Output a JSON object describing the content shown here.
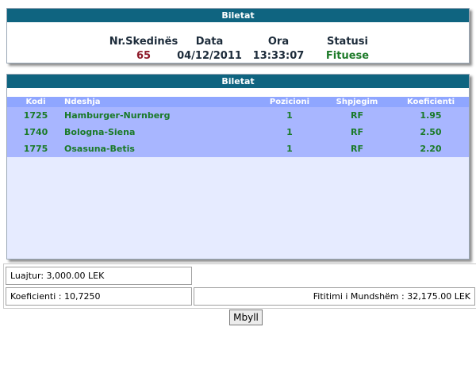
{
  "summary_panel": {
    "title": "Biletat",
    "headers": [
      "Nr.Skedinës",
      "Data",
      "Ora",
      "Statusi"
    ],
    "values": [
      "65",
      "04/12/2011",
      "13:33:07",
      "Fituese"
    ],
    "value_colors": [
      "#8e1a2a",
      "#1c2b3a",
      "#1c2b3a",
      "#1e7b2a"
    ]
  },
  "tickets_panel": {
    "title": "Biletat",
    "columns": [
      "Kodi",
      "Ndeshja",
      "Pozicioni",
      "Shpjegim",
      "Koeficienti"
    ],
    "rows": [
      [
        "1725",
        "Hamburger-Nurnberg",
        "1",
        "RF",
        "1.95"
      ],
      [
        "1740",
        "Bologna-Siena",
        "1",
        "RF",
        "2.50"
      ],
      [
        "1775",
        "Osasuna-Betis",
        "1",
        "RF",
        "2.20"
      ]
    ]
  },
  "footer": {
    "luajtur": "Luajtur: 3,000.00 LEK",
    "koeficienti": "Koeficienti : 10,7250",
    "fitimi": "Fititimi i Mundshëm : 32,175.00 LEK"
  },
  "close_button": {
    "label": "Mbyll"
  },
  "colors": {
    "header_bg": "#0f6480",
    "table_header_bg": "#8fa6ff",
    "row_bg": "#a8b6ff",
    "table_area_bg": "#e6ebff",
    "row_text": "#1a7a28"
  }
}
